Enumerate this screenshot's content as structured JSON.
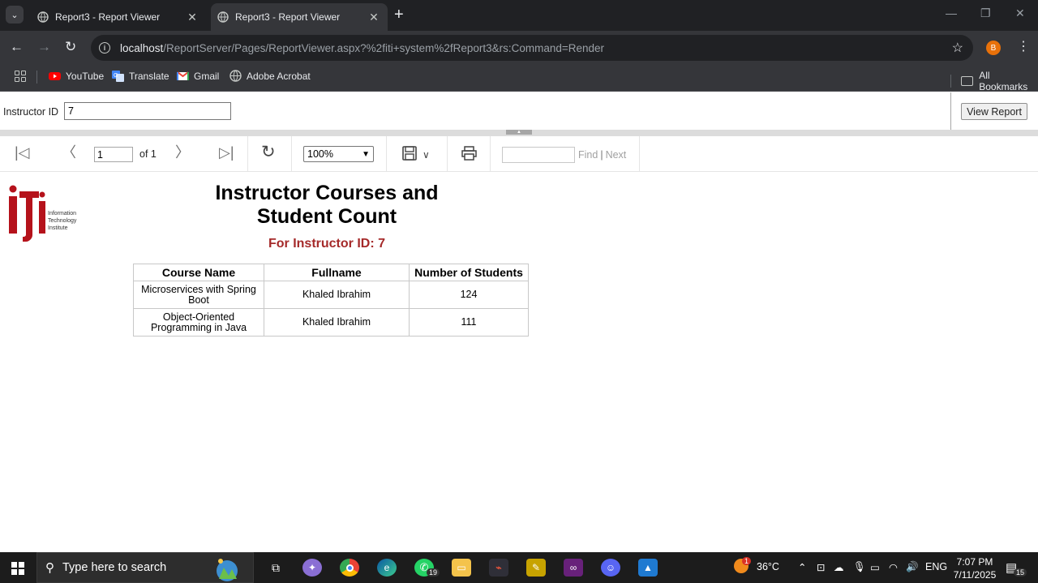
{
  "browser": {
    "tabs": [
      {
        "title": "Report3 - Report Viewer",
        "active": false
      },
      {
        "title": "Report3 - Report Viewer",
        "active": true
      }
    ],
    "url_host": "localhost",
    "url_path": "/ReportServer/Pages/ReportViewer.aspx?%2fiti+system%2fReport3&rs:Command=Render",
    "profile_initial": "B",
    "bookmarks": [
      "YouTube",
      "Translate",
      "Gmail",
      "Adobe Acrobat"
    ],
    "all_bookmarks": "All Bookmarks"
  },
  "parameters": {
    "label": "Instructor ID",
    "value": "7",
    "view_report": "View Report"
  },
  "report_toolbar": {
    "page_value": "1",
    "of_pages": "of 1",
    "zoom": "100%",
    "find_label": "Find",
    "next_label": "Next"
  },
  "report": {
    "logo_text": "Information Technology Institute",
    "title_line1": "Instructor Courses and",
    "title_line2": "Student Count",
    "subtitle": "For Instructor ID: 7",
    "columns": [
      "Course Name",
      "Fullname",
      "Number of Students"
    ],
    "rows": [
      {
        "course": "Microservices with Spring Boot",
        "fullname": "Khaled Ibrahim",
        "students": "124"
      },
      {
        "course": "Object-Oriented Programming in Java",
        "fullname": "Khaled Ibrahim",
        "students": "111"
      }
    ]
  },
  "taskbar": {
    "search_placeholder": "Type here to search",
    "whatsapp_badge": "19",
    "weather_badge": "1",
    "temperature": "36°C",
    "language": "ENG",
    "time": "7:07 PM",
    "date": "7/11/2025",
    "notifications": "15"
  },
  "colors": {
    "subtitle": "#a52a2a",
    "chrome_dark": "#202124",
    "chrome_toolbar": "#35363a"
  }
}
